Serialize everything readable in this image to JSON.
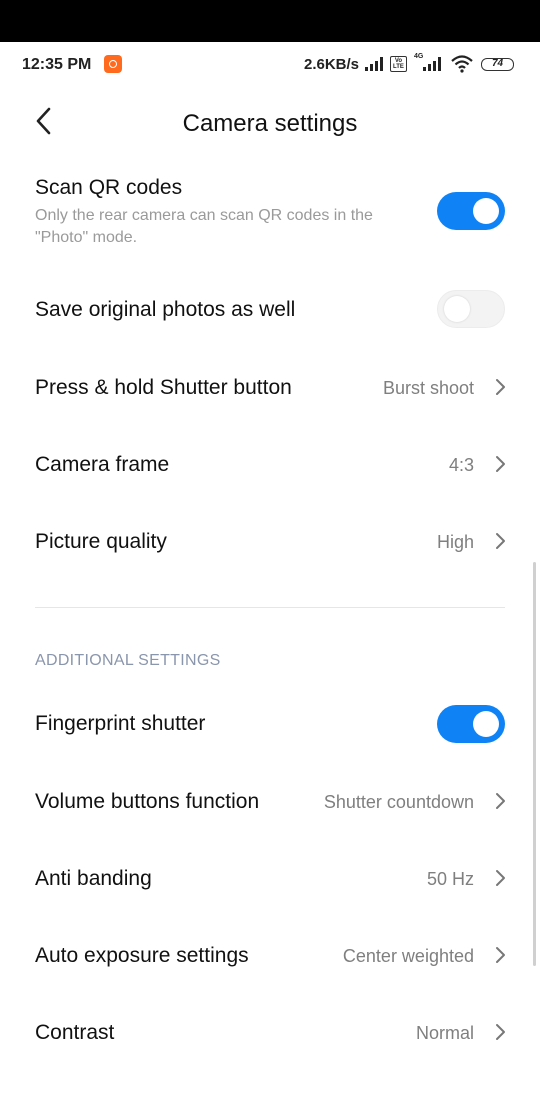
{
  "status_bar": {
    "time": "12:35 PM",
    "network_speed": "2.6KB/s",
    "volte_label": "Vo LTE",
    "network_type": "4G",
    "battery": "74"
  },
  "header": {
    "title": "Camera settings",
    "back_icon": "chevron-left-icon"
  },
  "settings": {
    "scan_qr": {
      "label": "Scan QR codes",
      "description": "Only the rear camera can scan QR codes in the \"Photo\" mode.",
      "enabled": true
    },
    "save_original": {
      "label": "Save original photos as well",
      "enabled": false
    },
    "press_hold": {
      "label": "Press & hold Shutter button",
      "value": "Burst shoot"
    },
    "camera_frame": {
      "label": "Camera frame",
      "value": "4:3"
    },
    "picture_quality": {
      "label": "Picture quality",
      "value": "High"
    }
  },
  "additional": {
    "section_title": "ADDITIONAL SETTINGS",
    "fingerprint": {
      "label": "Fingerprint shutter",
      "enabled": true
    },
    "volume_buttons": {
      "label": "Volume buttons function",
      "value": "Shutter countdown"
    },
    "anti_banding": {
      "label": "Anti banding",
      "value": "50 Hz"
    },
    "auto_exposure": {
      "label": "Auto exposure settings",
      "value": "Center weighted"
    },
    "contrast": {
      "label": "Contrast",
      "value": "Normal"
    }
  },
  "colors": {
    "accent": "#0f83f5",
    "section_header": "#8a96ac",
    "secondary_text": "#7f7f7f"
  }
}
